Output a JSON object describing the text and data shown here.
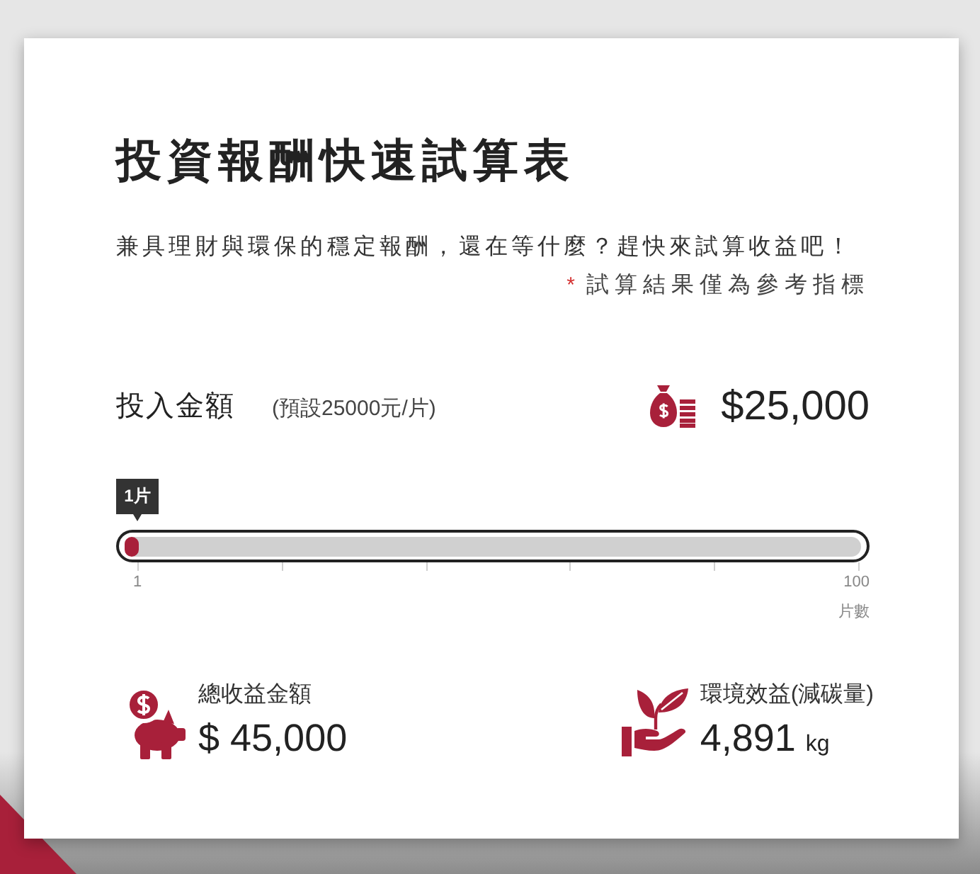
{
  "title": "投資報酬快速試算表",
  "intro": "兼具理財與環保的穩定報酬，還在等什麼？趕快來試算收益吧！",
  "note": {
    "mark": "*",
    "text": "試算結果僅為參考指標"
  },
  "investment": {
    "label": "投入金額",
    "hint": "(預設25000元/片)",
    "amount": "$25,000",
    "slider": {
      "tooltip": "1片",
      "level": 0,
      "min_label": "1",
      "max_label": "100",
      "unit_label": "片數"
    }
  },
  "results": [
    {
      "kind": "savings",
      "label": "總收益金額",
      "value": "$ 45,000"
    },
    {
      "kind": "carbon",
      "label": "環境效益(減碳量)",
      "value": "4,891",
      "unit": "kg"
    }
  ]
}
